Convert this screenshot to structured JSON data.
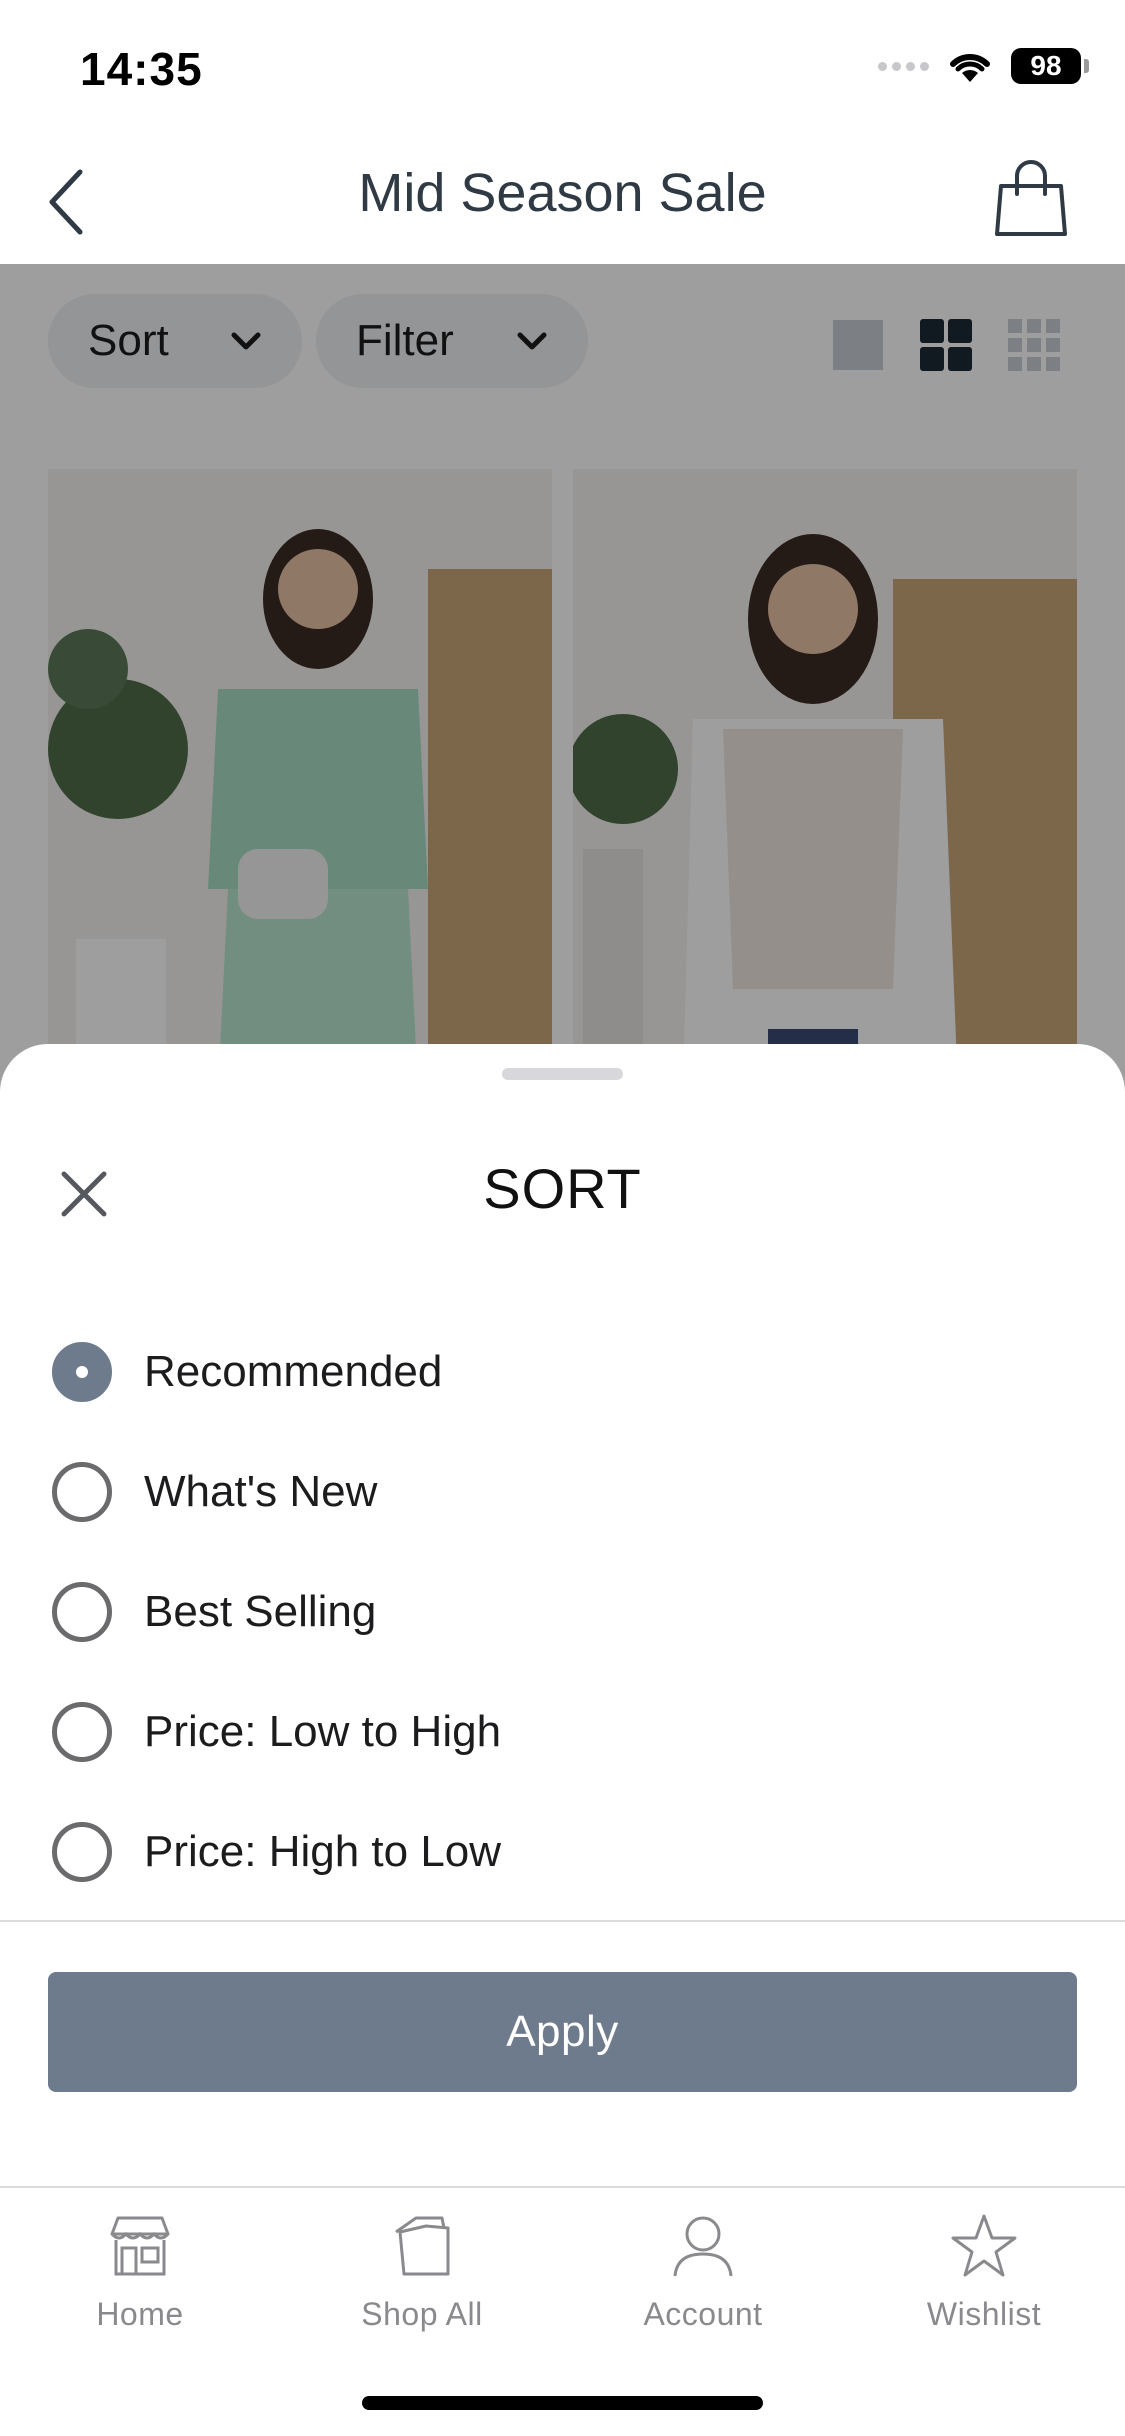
{
  "status_bar": {
    "time": "14:35",
    "battery": "98"
  },
  "header": {
    "title": "Mid Season Sale"
  },
  "toolbar": {
    "sort_label": "Sort",
    "filter_label": "Filter"
  },
  "sort_sheet": {
    "title": "SORT",
    "options": [
      {
        "label": "Recommended",
        "selected": true
      },
      {
        "label": "What's New",
        "selected": false
      },
      {
        "label": "Best Selling",
        "selected": false
      },
      {
        "label": "Price: Low to High",
        "selected": false
      },
      {
        "label": "Price: High to Low",
        "selected": false
      }
    ],
    "apply_label": "Apply"
  },
  "tabbar": {
    "items": [
      {
        "label": "Home",
        "icon": "store-icon"
      },
      {
        "label": "Shop All",
        "icon": "tags-icon"
      },
      {
        "label": "Account",
        "icon": "person-icon"
      },
      {
        "label": "Wishlist",
        "icon": "star-icon"
      }
    ]
  },
  "colors": {
    "accent": "#6e7b8d",
    "title": "#2f3a44",
    "tab_label": "#8a8a8e"
  }
}
